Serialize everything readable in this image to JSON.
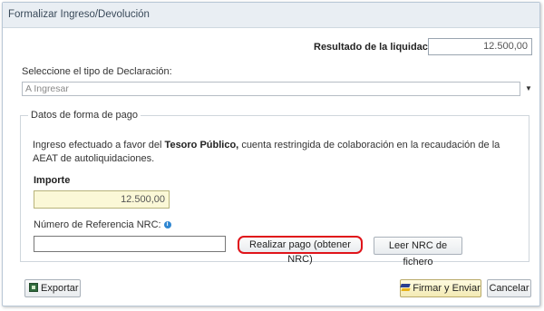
{
  "dialog": {
    "title": "Formalizar Ingreso/Devolución"
  },
  "resultado": {
    "label": "Resultado de la liquidación",
    "value": "12.500,00"
  },
  "declaracion": {
    "label": "Seleccione el tipo de Declaración:",
    "selected": "A Ingresar"
  },
  "pago": {
    "legend": "Datos de forma de pago",
    "info_prefix": "Ingreso efectuado a favor del",
    "info_bold": "Tesoro Público,",
    "info_suffix": "cuenta restringida de colaboración en la recaudación de la AEAT de autoliquidaciones.",
    "importe_label": "Importe",
    "importe_value": "12.500,00",
    "nrc_label": "Número de Referencia  NRC:",
    "nrc_value": ""
  },
  "buttons": {
    "realizar_pago": "Realizar pago (obtener NRC)",
    "leer_nrc": "Leer NRC de fichero",
    "exportar": "Exportar",
    "firmar": "Firmar y Enviar",
    "cancelar": "Cancelar"
  },
  "colors": {
    "highlight_border": "#e0141a",
    "importe_background": "#fbf8d7",
    "info_icon": "#2f86d1"
  },
  "icons": {
    "info": "info-icon",
    "dropdown": "chevron-down-icon",
    "export": "export-icon",
    "sign": "sign-icon"
  }
}
